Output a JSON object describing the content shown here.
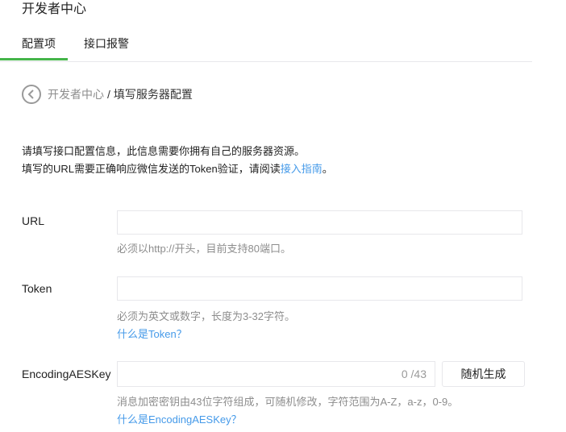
{
  "header": {
    "title": "开发者中心"
  },
  "tabs": [
    {
      "label": "配置项",
      "active": true
    },
    {
      "label": "接口报警",
      "active": false
    }
  ],
  "breadcrumb": {
    "back_icon": "chevron-left-circle-icon",
    "parent": "开发者中心",
    "separator": "/",
    "current": "填写服务器配置"
  },
  "intro": {
    "line1": "请填写接口配置信息，此信息需要你拥有自己的服务器资源。",
    "line2_prefix": "填写的URL需要正确响应微信发送的Token验证，请阅读",
    "line2_link": "接入指南",
    "line2_suffix": "。"
  },
  "form": {
    "url": {
      "label": "URL",
      "value": "",
      "hint": "必须以http://开头，目前支持80端口。"
    },
    "token": {
      "label": "Token",
      "value": "",
      "hint": "必须为英文或数字，长度为3-32字符。",
      "help_link": "什么是Token？"
    },
    "aeskey": {
      "label": "EncodingAESKey",
      "value": "",
      "counter": "0 /43",
      "generate_button": "随机生成",
      "hint": "消息加密密钥由43位字符组成，可随机修改，字符范围为A-Z，a-z，0-9。",
      "help_link": "什么是EncodingAESKey？"
    }
  },
  "colors": {
    "accent": "#44b549",
    "link": "#459ae9",
    "muted": "#8d8d8d",
    "border": "#e7e7eb"
  }
}
